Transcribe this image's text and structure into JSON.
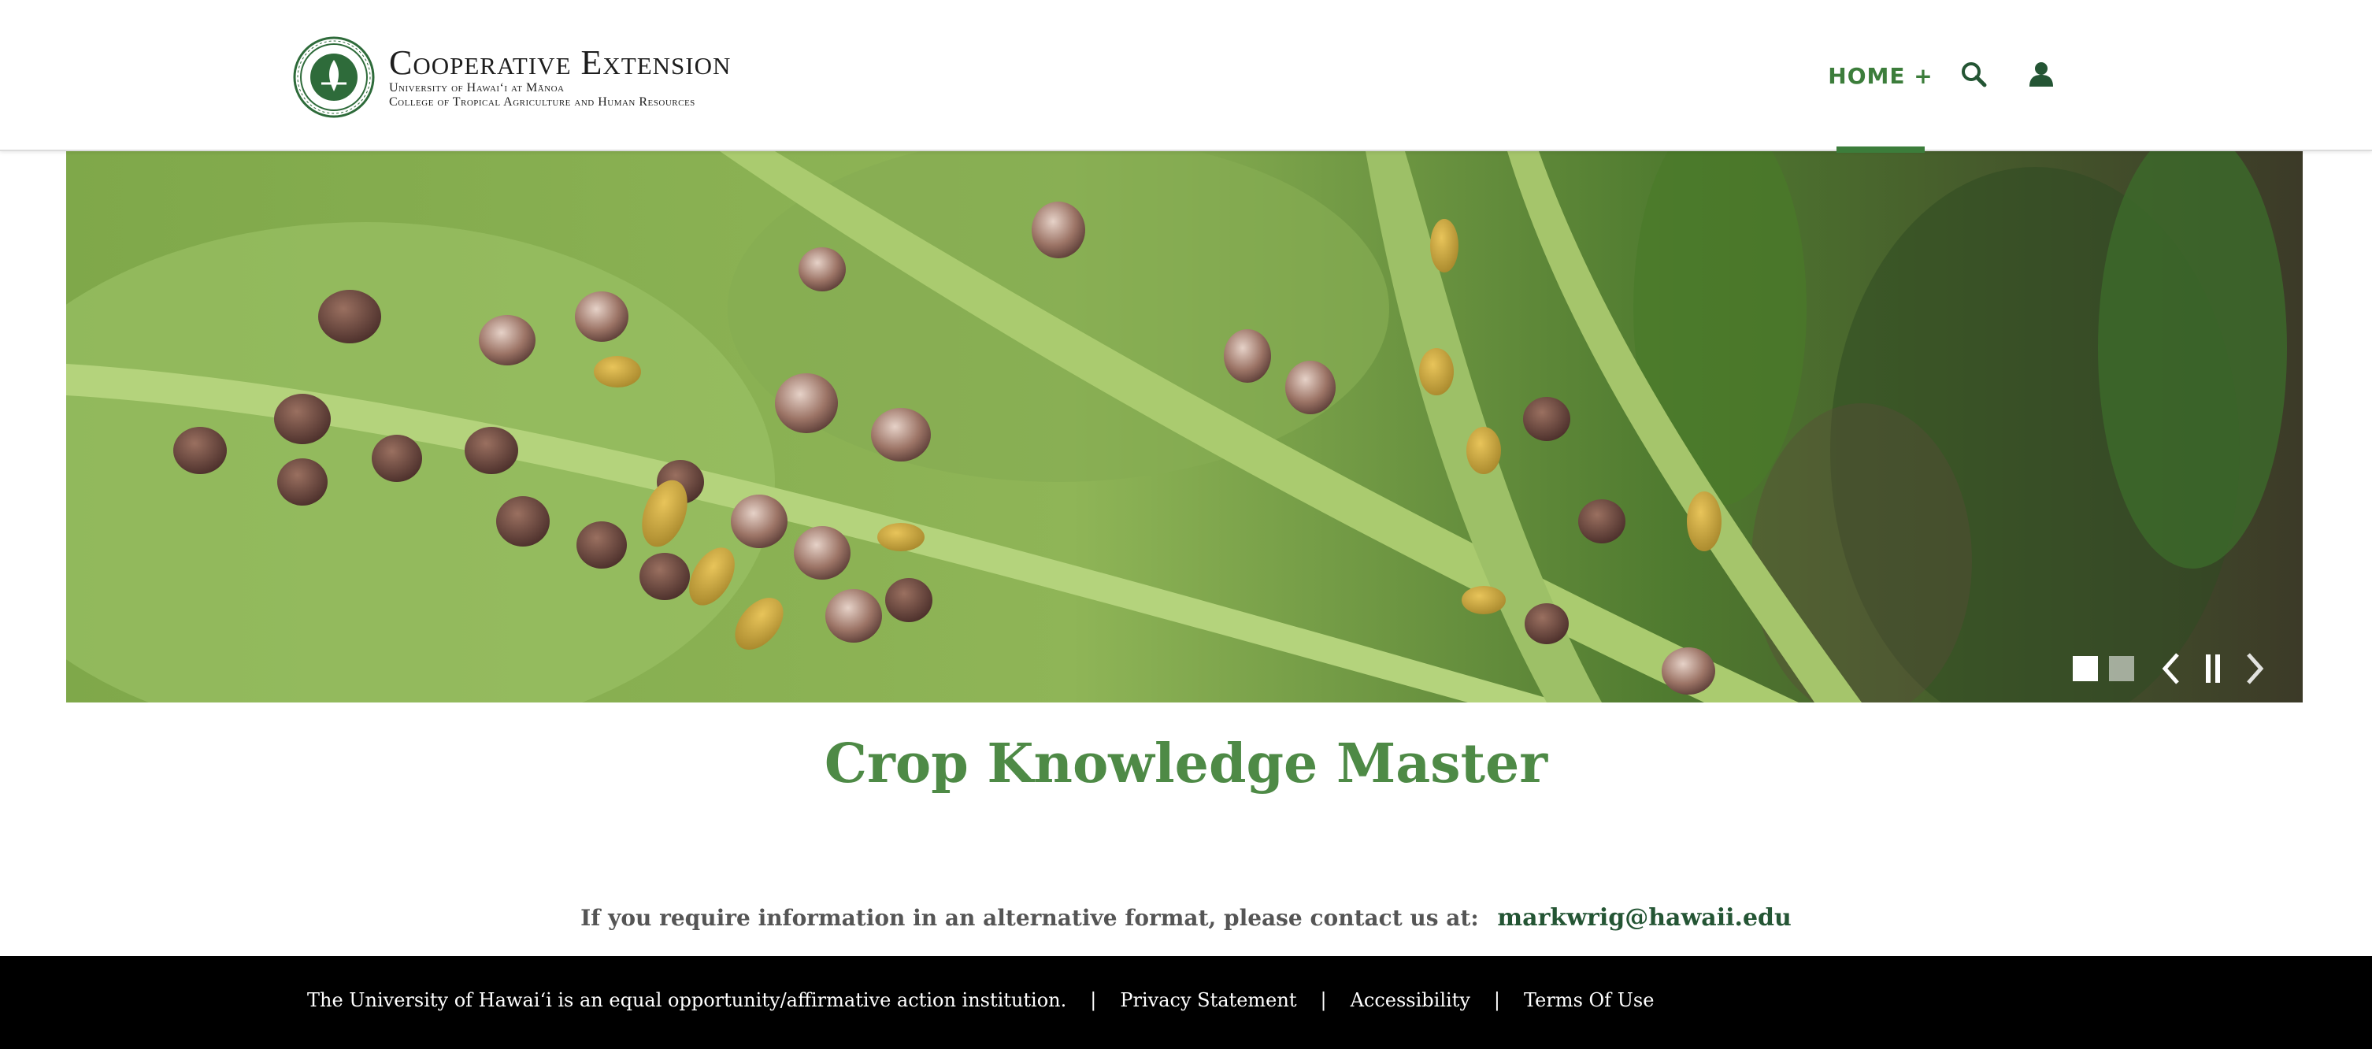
{
  "header": {
    "logo": {
      "title": "Cooperative Extension",
      "line1": "University of Hawai‘i at Mānoa",
      "line2": "College of Tropical Agriculture and Human Resources"
    },
    "nav": {
      "home_label": "HOME +",
      "search_icon": "search-icon",
      "user_icon": "user-icon"
    }
  },
  "hero": {
    "image": "close-up of aphids and bugs on green plant stems and leaves",
    "slide_count": 2,
    "active_slide": 1,
    "controls": [
      "previous",
      "pause",
      "next"
    ]
  },
  "main": {
    "title": "Crop Knowledge Master",
    "contact_text": "If you require information in an alternative format, please contact us at:",
    "contact_email": "markwrig@hawaii.edu"
  },
  "footer": {
    "statement": "The University of Hawai‘i is an equal opportunity/affirmative action institution.",
    "links": [
      "Privacy Statement",
      "Accessibility",
      "Terms Of Use"
    ],
    "separator": "|"
  },
  "colors": {
    "brand_green": "#4e8a46",
    "nav_green": "#3c7d3b",
    "dark_green": "#245534",
    "footer_bg": "#000000"
  }
}
